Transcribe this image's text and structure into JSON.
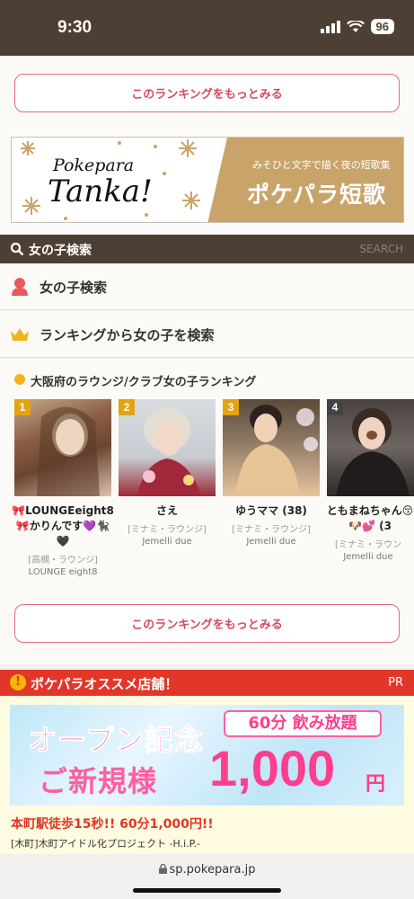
{
  "status": {
    "time": "9:30",
    "battery": "96"
  },
  "ranking_more_top": "このランキングをもっとみる",
  "banner": {
    "title1": "Pokepara",
    "title2": "Tanka!",
    "small": "みそひと文字で描く夜の短歌集",
    "big": "ポケパラ短歌"
  },
  "search": {
    "title": "女の子検索",
    "en": "SEARCH"
  },
  "menu": [
    {
      "label": "女の子検索",
      "icon": "person-icon"
    },
    {
      "label": "ランキングから女の子を検索",
      "icon": "crown-icon"
    }
  ],
  "ranking": {
    "title": "大阪府のラウンジ/クラブ女の子ランキング",
    "cards": [
      {
        "rank": "1",
        "name": "🎀LOUNGEeight8🎀かりんです💜🐈‍⬛🖤",
        "area": "[高槻・ラウンジ]",
        "shop": "LOUNGE eight8"
      },
      {
        "rank": "2",
        "name": "さえ",
        "area": "[ミナミ・ラウンジ]",
        "shop": "Jemelli due"
      },
      {
        "rank": "3",
        "name": "ゆうママ (38)",
        "area": "[ミナミ・ラウンジ]",
        "shop": "Jemelli due"
      },
      {
        "rank": "4",
        "name": "ともまねちゃん😚🐶💕 (3",
        "area": "[ミナミ・ラウン",
        "shop": "Jemelli due"
      }
    ],
    "more": "このランキングをもっとみる"
  },
  "pr": {
    "title": "ポケパラオススメ店舗！",
    "label": "PR",
    "ad_line1": "オープン記念",
    "ad_line2": "ご新規様",
    "ad_60": "60分 飲み放題",
    "ad_price": "1,000",
    "ad_yen": "円",
    "catch": "本町駅徒歩15秒!! 60分1,000円!!",
    "shop": "[木町]木町アイドル化プロジェクト -H.i.P.-"
  },
  "browser": {
    "url": "sp.pokepara.jp"
  },
  "colors": {
    "brown": "#4e3f34",
    "accent_pink": "#d94a5c",
    "red": "#e23628",
    "gold": "#e3a410"
  }
}
